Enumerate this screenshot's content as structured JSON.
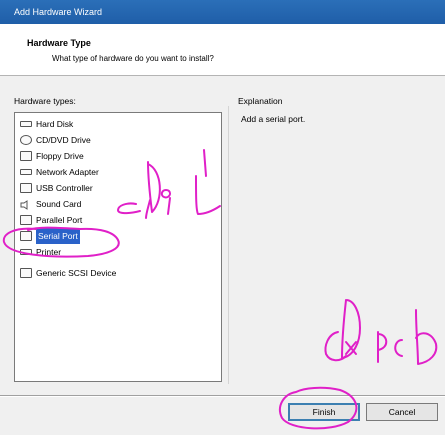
{
  "window": {
    "title": "Add Hardware Wizard"
  },
  "header": {
    "title": "Hardware Type",
    "subtitle": "What type of hardware do you want to install?"
  },
  "hardware_types": {
    "label": "Hardware types:",
    "items": [
      {
        "label": "Hard Disk",
        "icon": "hard-disk-icon"
      },
      {
        "label": "CD/DVD Drive",
        "icon": "cd-dvd-icon"
      },
      {
        "label": "Floppy Drive",
        "icon": "floppy-icon"
      },
      {
        "label": "Network Adapter",
        "icon": "network-icon"
      },
      {
        "label": "USB Controller",
        "icon": "usb-icon"
      },
      {
        "label": "Sound Card",
        "icon": "sound-icon"
      },
      {
        "label": "Parallel Port",
        "icon": "parallel-port-icon"
      },
      {
        "label": "Serial Port",
        "icon": "serial-port-icon",
        "selected": true
      },
      {
        "label": "Printer",
        "icon": "printer-icon"
      },
      {
        "label": "Generic SCSI Device",
        "icon": "scsi-icon"
      }
    ]
  },
  "explanation": {
    "label": "Explanation",
    "text": "Add a serial port."
  },
  "buttons": {
    "finish": "Finish",
    "cancel": "Cancel"
  },
  "annotations": {
    "ink_color": "#e020c8",
    "handwriting_1": "Do",
    "handwriting_2": "Apc"
  }
}
